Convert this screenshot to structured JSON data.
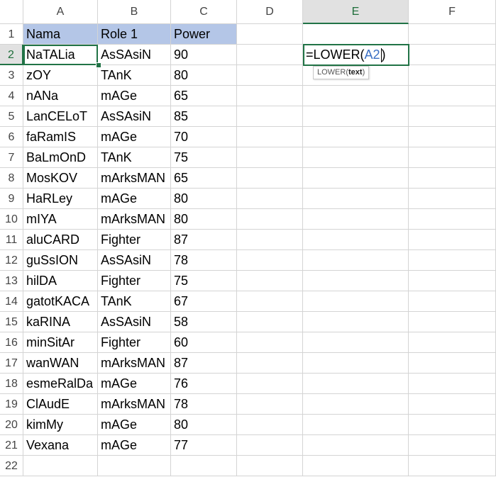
{
  "columns": [
    "A",
    "B",
    "C",
    "D",
    "E",
    "F"
  ],
  "active_column": "E",
  "active_row": "2",
  "rows": [
    {
      "num": "1",
      "a": "Nama",
      "b": "Role 1",
      "c": "Power"
    },
    {
      "num": "2",
      "a": "NaTALia",
      "b": "AsSAsiN",
      "c": "90"
    },
    {
      "num": "3",
      "a": "zOY",
      "b": "TAnK",
      "c": "80"
    },
    {
      "num": "4",
      "a": "nANa",
      "b": "mAGe",
      "c": "65"
    },
    {
      "num": "5",
      "a": "LanCELoT",
      "b": "AsSAsiN",
      "c": "85"
    },
    {
      "num": "6",
      "a": "faRamIS",
      "b": "mAGe",
      "c": "70"
    },
    {
      "num": "7",
      "a": "BaLmOnD",
      "b": "TAnK",
      "c": "75"
    },
    {
      "num": "8",
      "a": "MosKOV",
      "b": "mArksMAN",
      "c": "65"
    },
    {
      "num": "9",
      "a": "HaRLey",
      "b": "mAGe",
      "c": "80"
    },
    {
      "num": "10",
      "a": "mIYA",
      "b": "mArksMAN",
      "c": "80"
    },
    {
      "num": "11",
      "a": "aluCARD",
      "b": "Fighter",
      "c": "87"
    },
    {
      "num": "12",
      "a": "guSsION",
      "b": "AsSAsiN",
      "c": "78"
    },
    {
      "num": "13",
      "a": "hilDA",
      "b": "Fighter",
      "c": "75"
    },
    {
      "num": "14",
      "a": "gatotKACA",
      "b": "TAnK",
      "c": "67"
    },
    {
      "num": "15",
      "a": "kaRINA",
      "b": "AsSAsiN",
      "c": "58"
    },
    {
      "num": "16",
      "a": "minSitAr",
      "b": "Fighter",
      "c": "60"
    },
    {
      "num": "17",
      "a": "wanWAN",
      "b": "mArksMAN",
      "c": "87"
    },
    {
      "num": "18",
      "a": "esmeRalDa",
      "b": "mAGe",
      "c": "76"
    },
    {
      "num": "19",
      "a": "ClAudE",
      "b": "mArksMAN",
      "c": "78"
    },
    {
      "num": "20",
      "a": "kimMy",
      "b": "mAGe",
      "c": "80"
    },
    {
      "num": "21",
      "a": "Vexana",
      "b": "mAGe",
      "c": "77"
    },
    {
      "num": "22",
      "a": "",
      "b": "",
      "c": ""
    }
  ],
  "formula": {
    "prefix": "=LOWER(",
    "ref": "A2",
    "suffix": ")"
  },
  "tooltip": {
    "func": "LOWER(",
    "arg": "text",
    "close": ")"
  },
  "colors": {
    "header_fill": "#b4c6e7",
    "selection": "#217346",
    "reference": "#3a6fc4"
  }
}
